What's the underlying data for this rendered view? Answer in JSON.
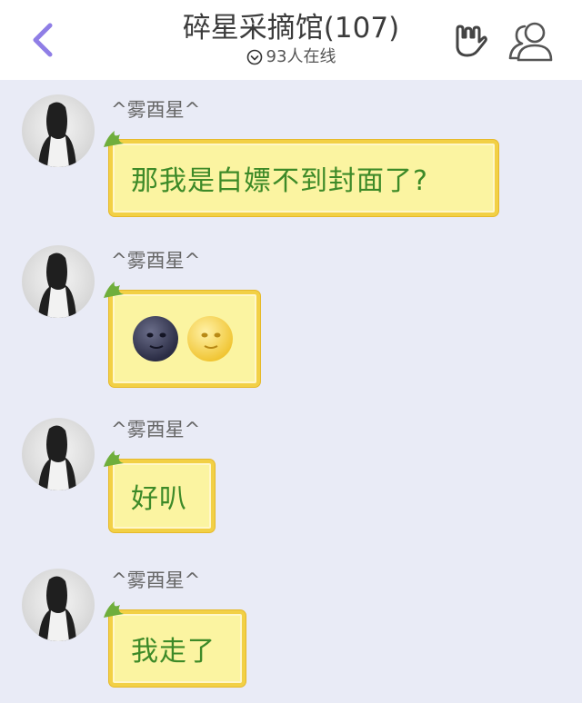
{
  "header": {
    "title": "碎星采摘馆(107)",
    "online_count": "93人在线"
  },
  "messages": [
    {
      "sender": "^雾酉星^",
      "text": "那我是白嫖不到封面了?"
    },
    {
      "sender": "^雾酉星^",
      "emojis": [
        "new-moon-face",
        "full-moon-face"
      ]
    },
    {
      "sender": "^雾酉星^",
      "text": "好叭"
    },
    {
      "sender": "^雾酉星^",
      "text": "我走了"
    }
  ],
  "colors": {
    "background": "#e9ebf6",
    "accent": "#8f7ee6",
    "bubble_fill": "#fbf4a1",
    "bubble_border": "#f2d045",
    "bubble_text": "#3d8a28"
  }
}
